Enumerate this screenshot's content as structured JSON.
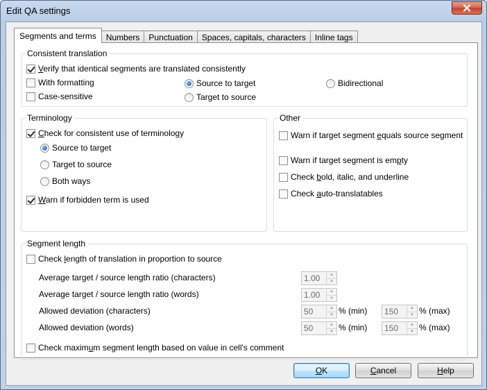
{
  "window": {
    "title": "Edit QA settings"
  },
  "tabs": [
    {
      "label": "Segments and terms",
      "active": true
    },
    {
      "label": "Numbers",
      "active": false
    },
    {
      "label": "Punctuation",
      "active": false
    },
    {
      "label": "Spaces, capitals, characters",
      "active": false
    },
    {
      "label": "Inline tags",
      "active": false
    }
  ],
  "consistent": {
    "legend": "Consistent translation",
    "verify": {
      "pre": "",
      "u": "V",
      "post": "erify that identical segments are translated consistently",
      "checked": true
    },
    "with_formatting": {
      "label": "With formatting",
      "checked": false
    },
    "case_sensitive": {
      "label": "Case-sensitive",
      "checked": false
    },
    "source_to_target": {
      "label": "Source to target",
      "checked": true
    },
    "target_to_source": {
      "label": "Target to source",
      "checked": false
    },
    "bidirectional": {
      "label": "Bidirectional",
      "checked": false
    }
  },
  "terminology": {
    "legend": "Terminology",
    "check": {
      "pre": "",
      "u": "C",
      "post": "heck for consistent use of terminology",
      "checked": true
    },
    "source_to_target": {
      "label": "Source to target",
      "checked": true
    },
    "target_to_source": {
      "label": "Target to source",
      "checked": false
    },
    "both_ways": {
      "label": "Both ways",
      "checked": false
    },
    "forbidden": {
      "pre": "",
      "u": "W",
      "post": "arn if forbidden term is used",
      "checked": true
    }
  },
  "other": {
    "legend": "Other",
    "equals": {
      "pre": "Warn if target segment ",
      "u": "e",
      "post": "quals source segment",
      "checked": false
    },
    "empty": {
      "pre": "Warn if target segment is em",
      "u": "p",
      "post": "ty",
      "checked": false
    },
    "bold": {
      "pre": "Check ",
      "u": "b",
      "post": "old, italic, and underline",
      "checked": false
    },
    "auto": {
      "pre": "Check ",
      "u": "a",
      "post": "uto-translatables",
      "checked": false
    }
  },
  "segment_length": {
    "legend": "Segment length",
    "check_length": {
      "pre": "Check ",
      "u": "l",
      "post": "ength of translation in proportion to source",
      "checked": false
    },
    "ratio_chars": {
      "label": "Average target / source length ratio (characters)",
      "value": "1.00"
    },
    "ratio_words": {
      "label": "Average target / source length ratio (words)",
      "value": "1.00"
    },
    "dev_chars": {
      "label": "Allowed deviation (characters)",
      "min": "50",
      "max": "150"
    },
    "dev_words": {
      "label": "Allowed deviation (words)",
      "min": "50",
      "max": "150"
    },
    "unit_min": "% (min)",
    "unit_max": "% (max)",
    "check_max": {
      "pre": "Check maxim",
      "u": "u",
      "post": "m segment length based on value in cell's comment",
      "checked": false
    }
  },
  "buttons": {
    "ok": {
      "u": "O",
      "post": "K"
    },
    "cancel": {
      "u": "C",
      "post": "ancel"
    },
    "help": {
      "u": "H",
      "post": "elp"
    }
  },
  "icons": {
    "close": "close-icon",
    "spin_up": "spin-up-icon",
    "spin_down": "spin-down-icon"
  }
}
